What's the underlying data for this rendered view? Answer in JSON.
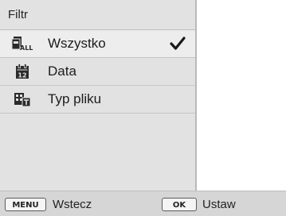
{
  "panel": {
    "title": "Filtr"
  },
  "menu": {
    "items": [
      {
        "label": "Wszystko",
        "icon": "all-files-icon",
        "selected": true
      },
      {
        "label": "Data",
        "icon": "calendar-icon",
        "selected": false
      },
      {
        "label": "Typ pliku",
        "icon": "file-type-icon",
        "selected": false
      }
    ],
    "check_icon": "checkmark-icon"
  },
  "footer": {
    "back_key": "MENU",
    "back_label": "Wstecz",
    "ok_key": "OK",
    "ok_label": "Ustaw"
  }
}
